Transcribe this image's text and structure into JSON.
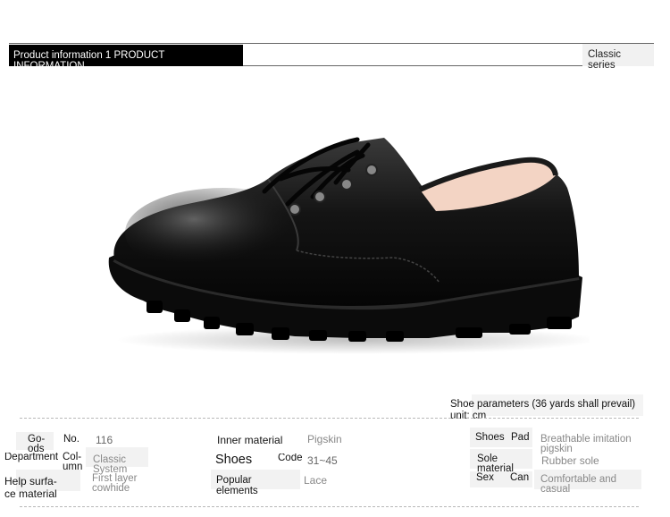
{
  "header": {
    "title": "Product information 1 PRODUCT INFORMATION",
    "series": "Classic series"
  },
  "params_note": "Shoe parameters (36 yards shall prevail) unit: cm",
  "table": {
    "r1": {
      "goods_label": "Go-ods",
      "no_label": "No.",
      "no_value": "116",
      "inner_label": "Inner material",
      "inner_value": "Pigskin",
      "shoes_label": "Shoes",
      "pad_label": "Pad",
      "pad_value": "Breathable imitation pigskin"
    },
    "r2": {
      "dept_label": "Department",
      "col_label": "Col-umn",
      "col_value": "Classic System",
      "shoes_label": "Shoes",
      "code_label": "Code",
      "code_value": "31~45",
      "sole_label": "Sole material",
      "sole_value": "Rubber sole"
    },
    "r3": {
      "help_label": "Help surfa-ce material",
      "help_value": "First layer cowhide",
      "popular_label": "Popular elements",
      "popular_value": "Lace",
      "sex_label": "Sex",
      "can_label": "Can",
      "can_value": "Comfortable and casual"
    }
  }
}
